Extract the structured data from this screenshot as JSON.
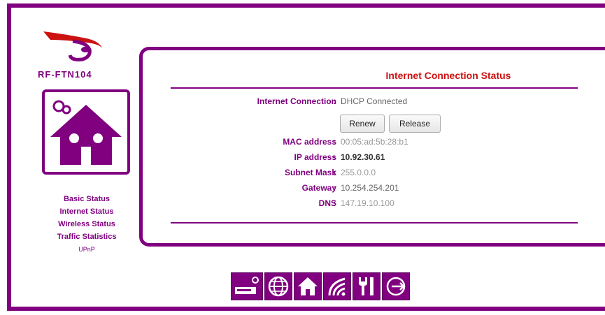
{
  "device": {
    "model": "RF-FTN104"
  },
  "sidebar": {
    "links": [
      {
        "label": "Basic Status"
      },
      {
        "label": "Internet Status"
      },
      {
        "label": "Wireless Status"
      },
      {
        "label": "Traffic Statistics"
      },
      {
        "label": "UPnP"
      }
    ]
  },
  "panel": {
    "title": "Internet Connection Status",
    "rows": {
      "internet_connection": {
        "label": "Internet Connection",
        "value": "DHCP Connected"
      },
      "mac": {
        "label": "MAC address",
        "value": "00:05:ad:5b:28:b1"
      },
      "ip": {
        "label": "IP address",
        "value": "10.92.30.61"
      },
      "subnet": {
        "label": "Subnet Mask",
        "value": "255.0.0.0"
      },
      "gateway": {
        "label": "Gateway",
        "value": "10.254.254.201"
      },
      "dns": {
        "label": "DNS",
        "value": "147.19.10.100"
      }
    },
    "buttons": {
      "renew": "Renew",
      "release": "Release"
    }
  },
  "toolbar": {
    "icons": [
      "modem-icon",
      "globe-icon",
      "home-icon",
      "wireless-icon",
      "tools-icon",
      "logout-icon"
    ]
  },
  "colors": {
    "accent": "#800080",
    "title": "#cc1111"
  }
}
